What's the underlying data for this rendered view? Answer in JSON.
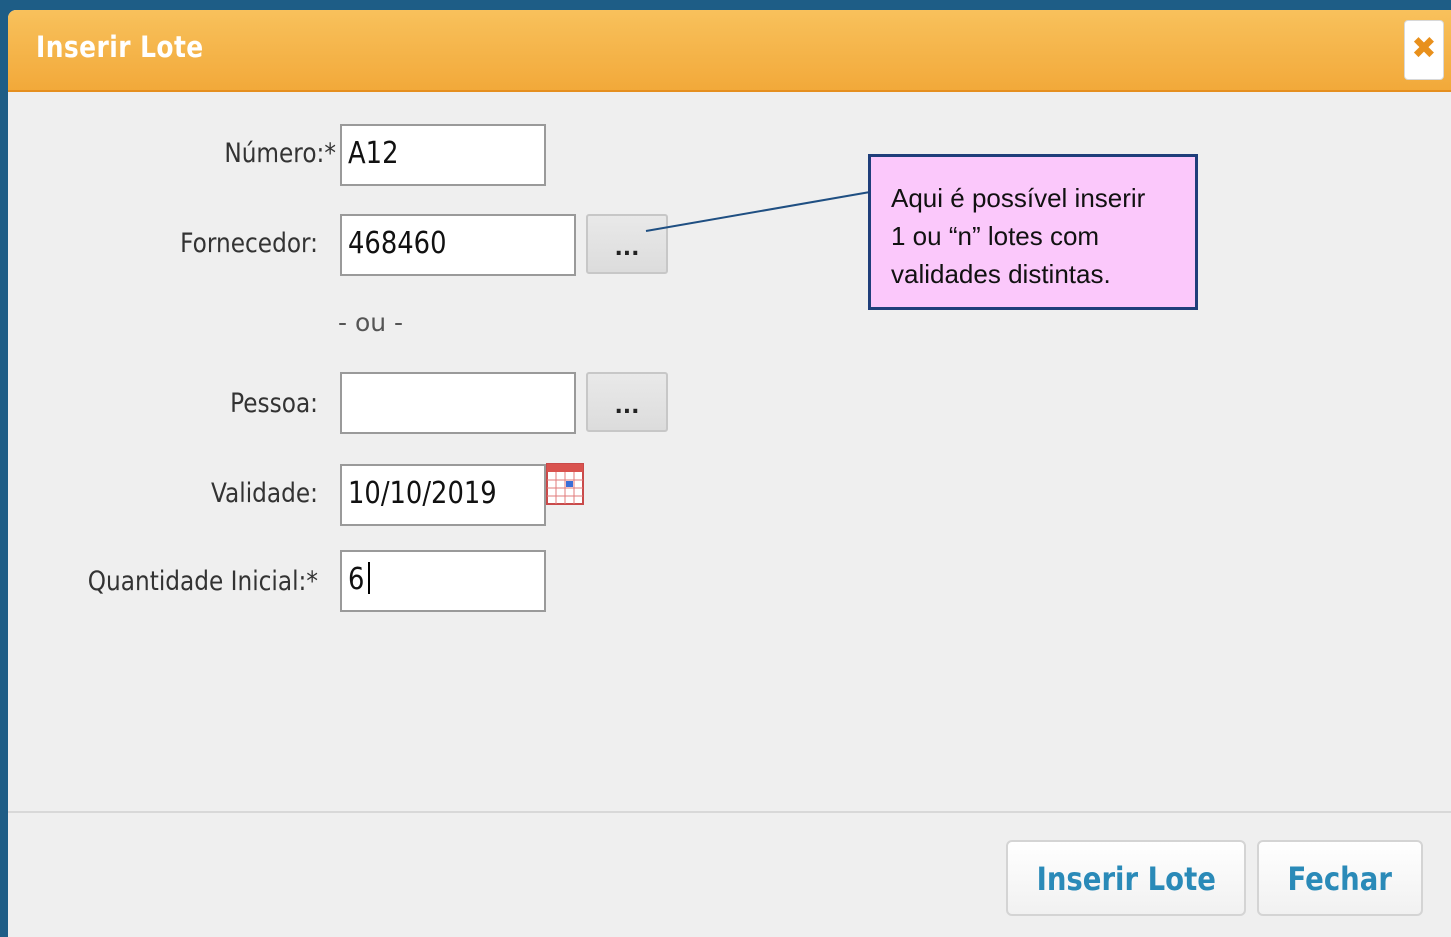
{
  "dialog": {
    "title": "Inserir Lote",
    "close_icon": "close-icon",
    "close_glyph": "✖"
  },
  "form": {
    "numero": {
      "label": "Número:*",
      "value": "A12"
    },
    "fornecedor": {
      "label": "Fornecedor:",
      "value": "468460",
      "lookup_label": "..."
    },
    "separator_text": "- ou -",
    "pessoa": {
      "label": "Pessoa:",
      "value": "",
      "lookup_label": "..."
    },
    "validade": {
      "label": "Validade:",
      "value": "10/10/2019",
      "calendar_icon": "calendar-icon"
    },
    "quantidade": {
      "label": "Quantidade Inicial:*",
      "value": "6"
    }
  },
  "footer": {
    "insert_label": "Inserir Lote",
    "close_label": "Fechar"
  },
  "callout": {
    "line1": "Aqui é possível inserir",
    "line2": "1 ou “n” lotes com",
    "line3": "validades distintas."
  },
  "colors": {
    "background": "#1e5d86",
    "titlebar": "#f2a93a",
    "dialog_body": "#efefef",
    "button_text": "#2a8ab8",
    "callout_bg": "#fbc8fb",
    "callout_border": "#1f3e7a"
  }
}
